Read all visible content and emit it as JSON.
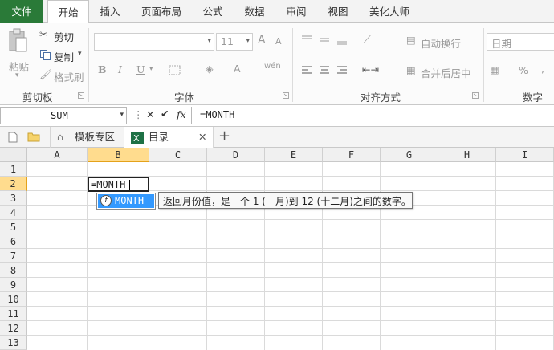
{
  "ribbon_tabs": [
    "文件",
    "开始",
    "插入",
    "页面布局",
    "公式",
    "数据",
    "审阅",
    "视图",
    "美化大师"
  ],
  "clipboard": {
    "paste": "粘贴",
    "cut": "剪切",
    "copy": "复制",
    "format_painter": "格式刷",
    "group_label": "剪切板"
  },
  "font": {
    "size_value": "11",
    "bold": "B",
    "italic": "I",
    "underline": "U",
    "group_label": "字体",
    "grow": "A",
    "shrink": "A",
    "color_letter": "A",
    "phonetic": "wén"
  },
  "alignment": {
    "wrap_text": "自动换行",
    "merge_center": "合并后居中",
    "group_label": "对齐方式"
  },
  "number": {
    "format_value": "日期",
    "percent": "%",
    "comma": ",",
    "group_label": "数字"
  },
  "formula_bar": {
    "name_box": "SUM",
    "fx": "fx",
    "formula": "=MONTH"
  },
  "doc_tabs": {
    "template": "模板专区",
    "workbook": "目录",
    "add": "+",
    "close": "✕"
  },
  "sheet": {
    "columns": [
      "A",
      "B",
      "C",
      "D",
      "E",
      "F",
      "G",
      "H",
      "I"
    ],
    "rows": [
      "1",
      "2",
      "3",
      "4",
      "5",
      "6",
      "7",
      "8",
      "9",
      "10",
      "11",
      "12",
      "13"
    ],
    "active_cell_value": "=MONTH",
    "autocomplete_item": "MONTH",
    "tooltip": "返回月份值，是一个 1 (一月)到 12 (十二月)之间的数字。"
  }
}
